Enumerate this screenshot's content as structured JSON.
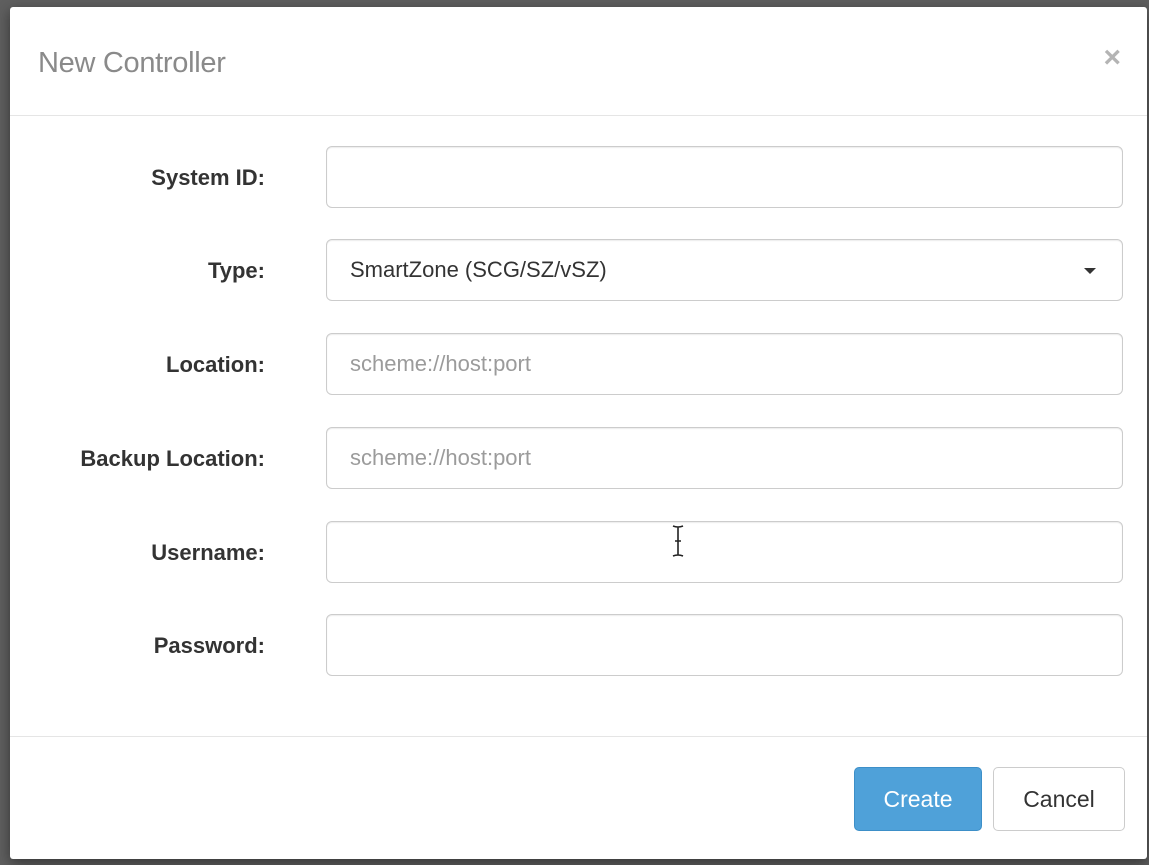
{
  "dialog": {
    "title": "New Controller",
    "close_symbol": "×"
  },
  "form": {
    "system_id": {
      "label": "System ID:",
      "value": "",
      "placeholder": ""
    },
    "type": {
      "label": "Type:",
      "selected": "SmartZone (SCG/SZ/vSZ)"
    },
    "location": {
      "label": "Location:",
      "value": "",
      "placeholder": "scheme://host:port"
    },
    "backup_location": {
      "label": "Backup Location:",
      "value": "",
      "placeholder": "scheme://host:port"
    },
    "username": {
      "label": "Username:",
      "value": "",
      "placeholder": ""
    },
    "password": {
      "label": "Password:",
      "value": "",
      "placeholder": ""
    }
  },
  "footer": {
    "create_label": "Create",
    "cancel_label": "Cancel"
  },
  "colors": {
    "primary": "#4fa1d9",
    "title": "#8a8a8a",
    "label": "#333333",
    "placeholder": "#9b9b9b"
  },
  "icons": {
    "close": "close-icon",
    "caret": "caret-down-icon",
    "cursor": "text-cursor-icon"
  }
}
